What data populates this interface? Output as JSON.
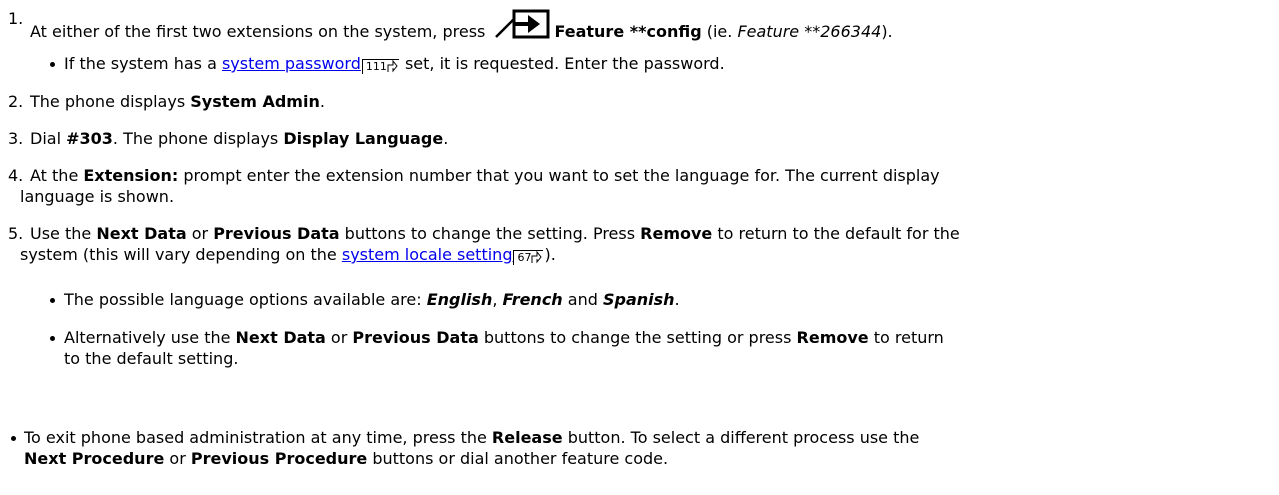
{
  "steps": {
    "s1": {
      "num": "1.",
      "pre": "At either of the first two extensions on the system, press ",
      "feature": "Feature **config",
      "mid": " (ie. ",
      "feature_code": "Feature **266344",
      "post": ")."
    },
    "s1b": {
      "pre": "If the system has a ",
      "link": "system password",
      "ref": "111",
      "post": " set, it is requested. Enter the password."
    },
    "s2": {
      "num": "2.",
      "pre": "The phone displays ",
      "bold": "System Admin",
      "post": "."
    },
    "s3": {
      "num": "3.",
      "pre": "Dial ",
      "code": "#303",
      "mid": ". The phone displays ",
      "bold": "Display Language",
      "post": "."
    },
    "s4": {
      "num": "4.",
      "pre": "At the ",
      "bold": "Extension:",
      "line1_post": " prompt enter the extension number that you want to set the language for. The current display",
      "line2": "language is shown."
    },
    "s5": {
      "num": "5.",
      "pre": "Use the ",
      "next": "Next Data",
      "or": " or ",
      "prev": "Previous Data",
      "mid": " buttons to change the setting. Press ",
      "remove": "Remove",
      "line1_post": " to return to the default for the",
      "line2_pre": "system (this will vary depending on the ",
      "link": "system locale setting",
      "ref": "67",
      "line2_post": ")."
    },
    "s5a": {
      "pre": "The possible language options available are: ",
      "l1": "English",
      "sep1": ", ",
      "l2": "French",
      "sep2": " and ",
      "l3": "Spanish",
      "post": "."
    },
    "s5b": {
      "pre": "Alternatively use the ",
      "next": "Next Data",
      "or": " or ",
      "prev": "Previous Data",
      "mid": " buttons to change the setting or press ",
      "remove": "Remove",
      "line1_post": " to return",
      "line2": "to the default setting."
    },
    "exit": {
      "pre": "To exit phone based administration at any time, press the ",
      "release": "Release",
      "mid": " button. To select a different process use the",
      "next_proc": "Next Procedure",
      "or": " or ",
      "prev_proc": "Previous Procedure",
      "post": " buttons or dial another feature code."
    }
  },
  "icons": {
    "feature": "feature-button-icon",
    "ref_arrow": "page-reference-arrow-icon"
  }
}
